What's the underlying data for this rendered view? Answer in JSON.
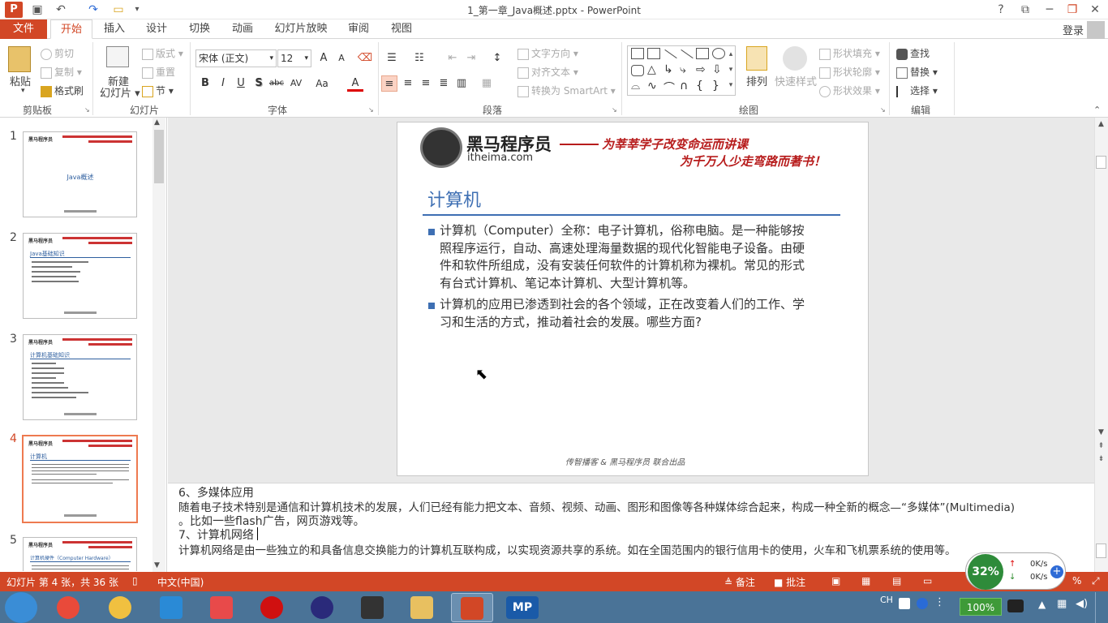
{
  "window": {
    "app_logo": "P",
    "title": "1_第一章_Java概述.pptx - PowerPoint",
    "help": "?",
    "restore_ribbon": "⧉",
    "minimize": "─",
    "restore": "❐",
    "close": "✕"
  },
  "quick_access": {
    "save": "💾",
    "undo": "↶",
    "redo": "↷",
    "open": "📂",
    "customize": "▾"
  },
  "tabs": [
    {
      "label": "文件"
    },
    {
      "label": "开始"
    },
    {
      "label": "插入"
    },
    {
      "label": "设计"
    },
    {
      "label": "切换"
    },
    {
      "label": "动画"
    },
    {
      "label": "幻灯片放映"
    },
    {
      "label": "审阅"
    },
    {
      "label": "视图"
    }
  ],
  "account": {
    "login": "登录"
  },
  "ribbon": {
    "clipboard": {
      "paste": "粘贴",
      "cut": "剪切",
      "copy": "复制",
      "format_painter": "格式刷",
      "label": "剪贴板"
    },
    "slides": {
      "new_slide": "新建",
      "new_slide2": "幻灯片",
      "layout": "版式",
      "reset": "重置",
      "section": "节",
      "label": "幻灯片"
    },
    "font": {
      "name": "宋体 (正文)",
      "size": "12",
      "grow": "A",
      "shrink": "A",
      "bold": "B",
      "italic": "I",
      "underline": "U",
      "shadow": "S",
      "strike": "abc",
      "spacing": "AV",
      "case": "Aa",
      "color": "A",
      "label": "字体"
    },
    "paragraph": {
      "text_direction": "文字方向",
      "align_text": "对齐文本",
      "smartart": "转换为 SmartArt",
      "label": "段落"
    },
    "drawing": {
      "arrange": "排列",
      "quick_styles": "快速样式",
      "fill": "形状填充",
      "outline": "形状轮廓",
      "effects": "形状效果",
      "label": "绘图"
    },
    "editing": {
      "find": "查找",
      "replace": "替换",
      "select": "选择",
      "label": "编辑"
    }
  },
  "thumbnails": [
    {
      "num": "1",
      "title": "Java概述"
    },
    {
      "num": "2",
      "title": "Java基础知识"
    },
    {
      "num": "3",
      "title": "计算机基础知识"
    },
    {
      "num": "4",
      "title": "计算机"
    },
    {
      "num": "5",
      "title": "计算机硬件（Computer Hardware）"
    }
  ],
  "slide": {
    "logo_name": "黑马程序员",
    "logo_url": "itheima.com",
    "slogan1": "为莘莘学子改变命运而讲课",
    "slogan2": "为千万人少走弯路而著书！",
    "title": "计算机",
    "bullets": [
      {
        "lines": [
          "计算机（Computer）全称：电子计算机，俗称电脑。是一种能够按",
          "照程序运行，自动、高速处理海量数据的现代化智能电子设备。由硬",
          "件和软件所组成，没有安装任何软件的计算机称为裸机。常见的形式",
          "有台式计算机、笔记本计算机、大型计算机等。"
        ]
      },
      {
        "lines": [
          "计算机的应用已渗透到社会的各个领域，正在改变着人们的工作、学",
          "习和生活的方式，推动着社会的发展。哪些方面?"
        ]
      }
    ],
    "footer": "传智播客 & 黑马程序员 联合出品"
  },
  "notes": {
    "line1": "6、多媒体应用",
    "line2": "随着电子技术特别是通信和计算机技术的发展，人们已经有能力把文本、音频、视频、动画、图形和图像等各种媒体综合起来，构成一种全新的概念—“多媒体”(Multimedia)",
    "line3": "。比如一些flash广告，网页游戏等。",
    "line4": "7、计算机网络",
    "line5": "计算机网络是由一些独立的和具备信息交换能力的计算机互联构成，以实现资源共享的系统。如在全国范围内的银行信用卡的使用，火车和飞机票系统的使用等。"
  },
  "status": {
    "slide_info": "幻灯片 第 4 张，共 36 张",
    "language": "中文(中国)",
    "notes_btn": "备注",
    "comments_btn": "批注",
    "zoom_pct": "%"
  },
  "net_widget": {
    "percent": "32%",
    "up": "0K/s",
    "down": "0K/s",
    "plus": "+"
  },
  "taskbar": {
    "tray_lang": "CH",
    "battery": "100%"
  },
  "colors": {
    "accent": "#d24726",
    "slide_title": "#3e6fb3",
    "slogan": "#b71c1c"
  }
}
